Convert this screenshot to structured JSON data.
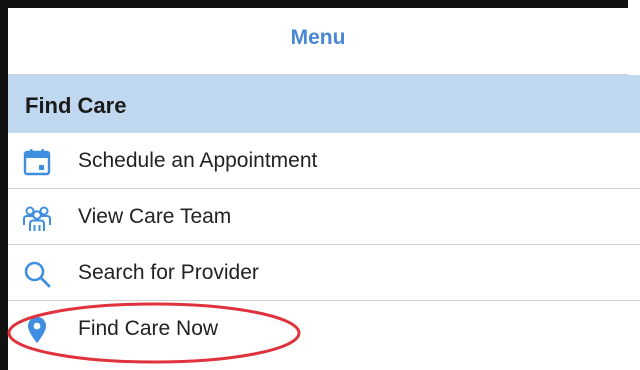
{
  "menu": {
    "title": "Menu"
  },
  "section": {
    "title": "Find Care"
  },
  "items": [
    {
      "label": "Schedule an Appointment",
      "icon": "calendar-icon"
    },
    {
      "label": "View Care Team",
      "icon": "care-team-icon"
    },
    {
      "label": "Search for Provider",
      "icon": "search-icon"
    },
    {
      "label": "Find Care Now",
      "icon": "location-pin-icon"
    }
  ],
  "colors": {
    "accent": "#4a86d6",
    "section_background": "#bfd8f0",
    "highlight_ring": "#e0323c"
  }
}
